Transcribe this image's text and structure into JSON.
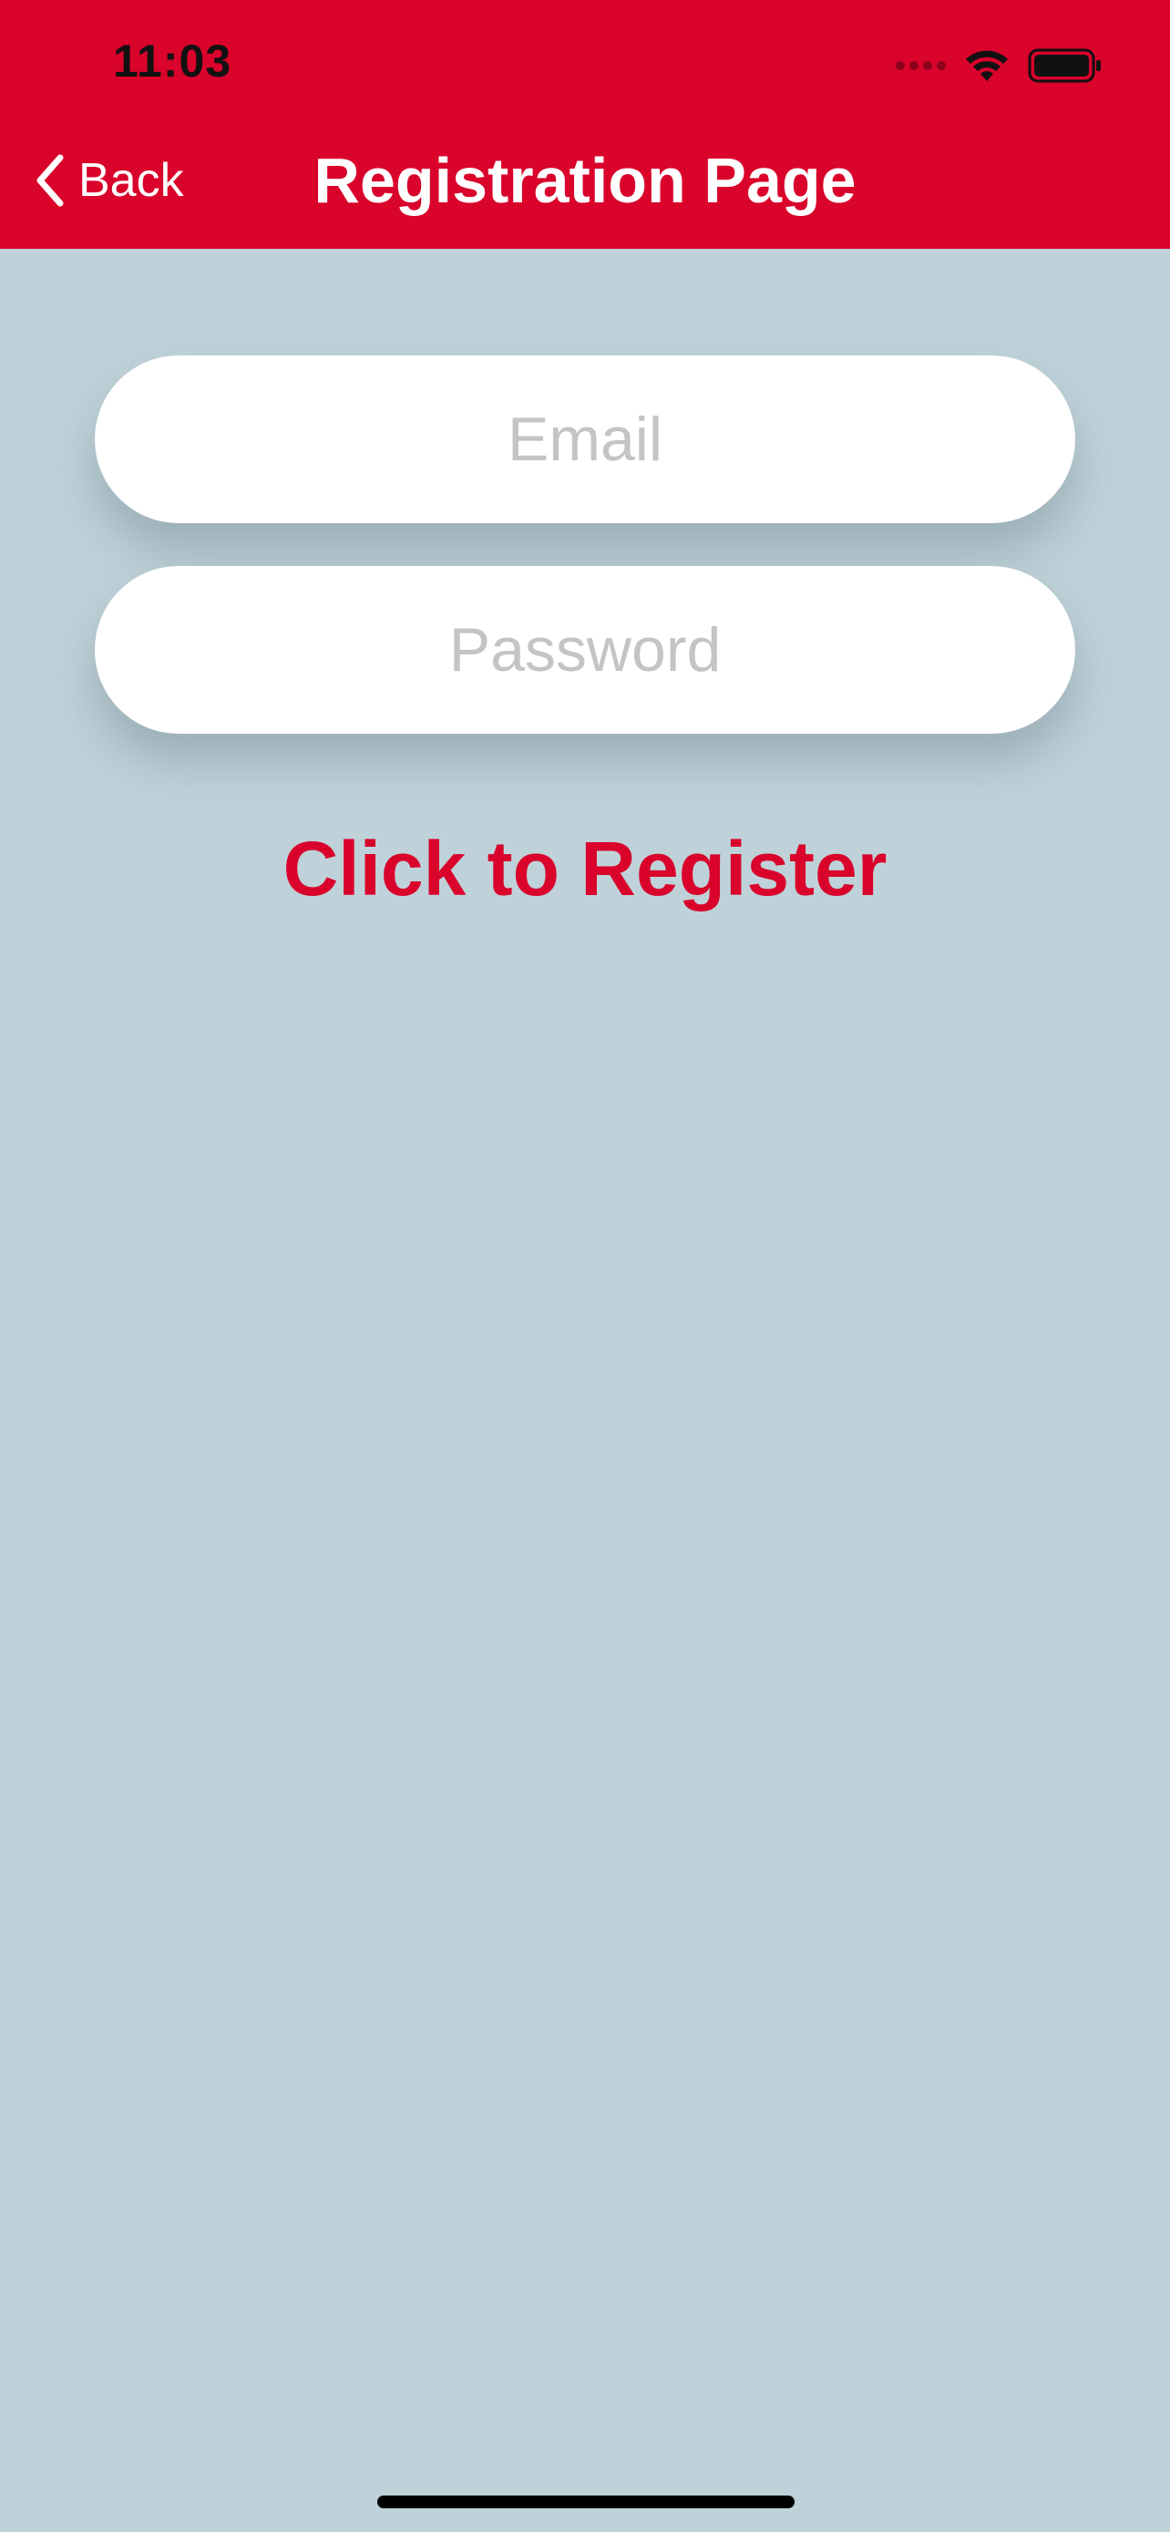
{
  "status_bar": {
    "time": "11:03",
    "icons": [
      "cellular-dots-icon",
      "wifi-icon",
      "battery-icon"
    ]
  },
  "nav": {
    "back_label": "Back",
    "back_icon": "chevron-left-icon",
    "title": "Registration Page"
  },
  "form": {
    "email": {
      "placeholder": "Email",
      "value": ""
    },
    "password": {
      "placeholder": "Password",
      "value": ""
    },
    "register_label": "Click to Register"
  },
  "colors": {
    "accent": "#d9032b",
    "background": "#bfd2d9",
    "field": "#ffffff",
    "placeholder": "#c4c4c6"
  }
}
